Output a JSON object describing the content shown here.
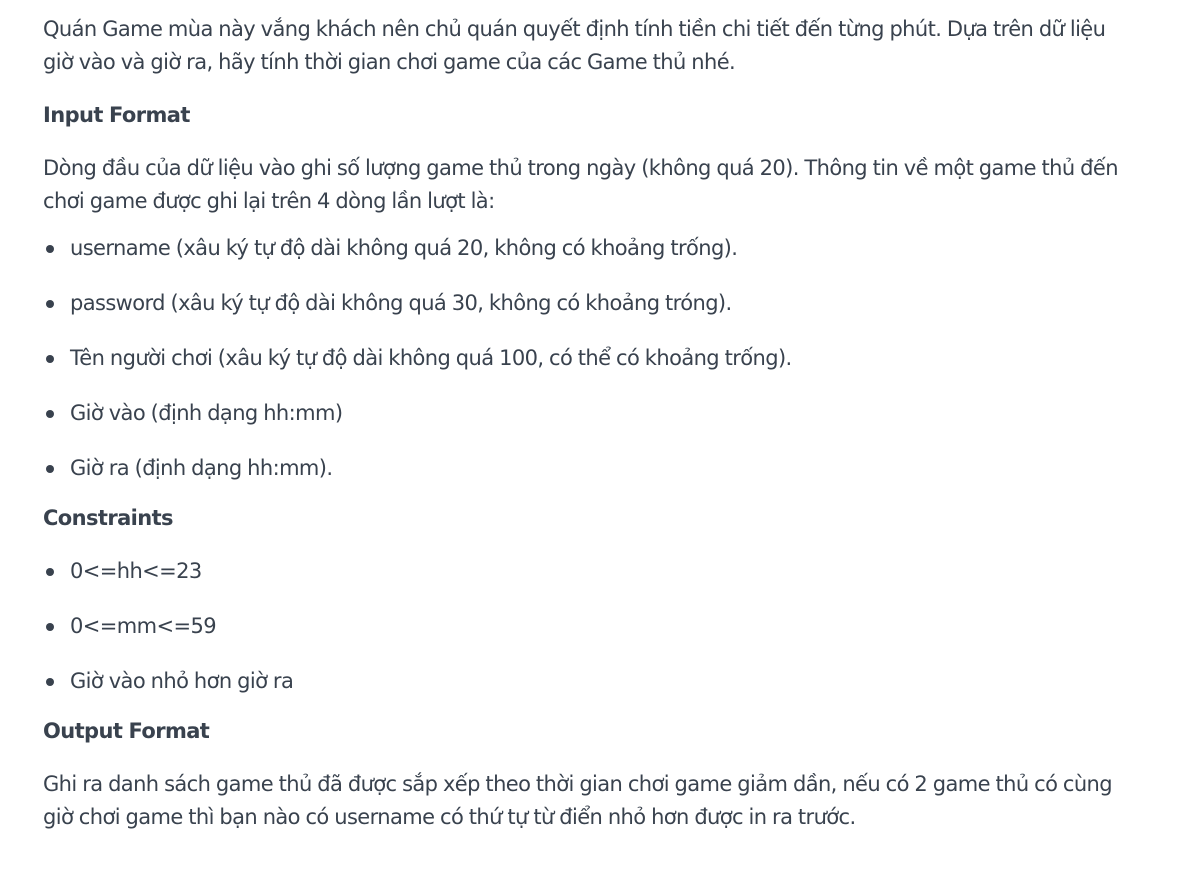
{
  "intro": "Quán Game mùa này vắng khách nên chủ quán quyết định tính tiền chi tiết đến từng phút. Dựa trên dữ liệu giờ vào và giờ ra, hãy tính thời gian chơi game của các Game thủ nhé.",
  "input_format": {
    "heading": "Input Format",
    "description": "Dòng đầu của dữ liệu vào ghi số lượng game thủ trong ngày (không quá 20). Thông tin về một game thủ đến chơi game được ghi lại trên 4 dòng lần lượt là:",
    "items": [
      "username (xâu ký tự độ dài không quá 20, không có khoảng trống).",
      "password (xâu ký tự độ dài không quá 30, không có khoảng tróng).",
      "Tên người chơi (xâu ký tự độ dài không quá 100, có thể có khoảng trống).",
      "Giờ vào (định dạng hh:mm)",
      "Giờ ra (định dạng hh:mm)."
    ]
  },
  "constraints": {
    "heading": "Constraints",
    "items": [
      "0<=hh<=23",
      "0<=mm<=59",
      "Giờ vào nhỏ hơn giờ ra"
    ]
  },
  "output_format": {
    "heading": "Output Format",
    "description": "Ghi ra danh sách game thủ đã được sắp xếp theo thời gian chơi game giảm dần, nếu có 2 game thủ có cùng giờ chơi game thì bạn nào có username có thứ tự từ điển nhỏ hơn được in ra trước."
  }
}
